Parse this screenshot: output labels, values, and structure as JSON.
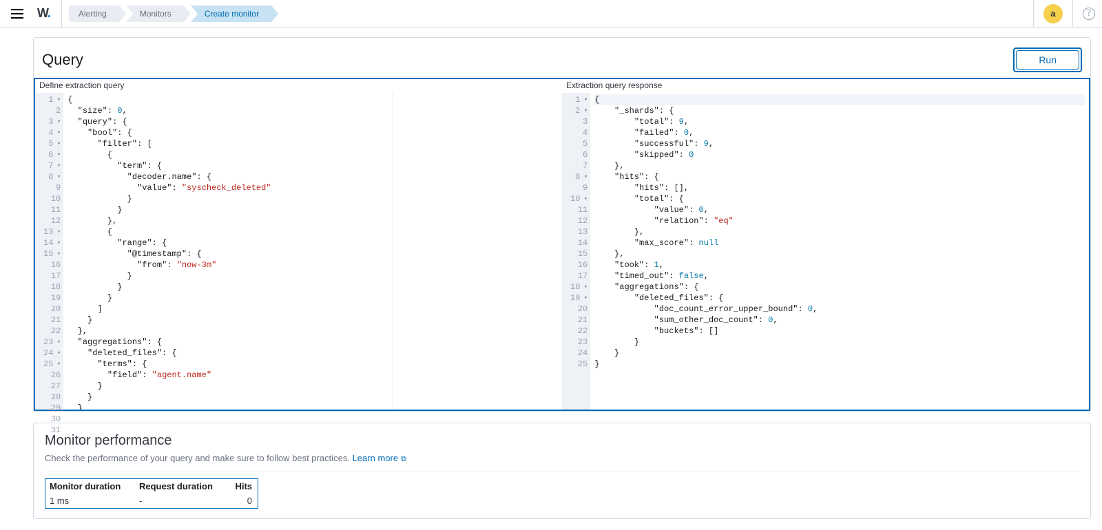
{
  "header": {
    "logo_text": "W",
    "avatar_letter": "a",
    "breadcrumbs": [
      "Alerting",
      "Monitors",
      "Create monitor"
    ]
  },
  "query_panel": {
    "title": "Query",
    "run_label": "Run",
    "left_label": "Define extraction query",
    "right_label": "Extraction query response"
  },
  "query_editor": {
    "lines": [
      {
        "n": 1,
        "fold": true,
        "tokens": [
          [
            "{",
            "punc"
          ]
        ]
      },
      {
        "n": 2,
        "tokens": [
          [
            "  ",
            ""
          ],
          [
            "\"size\"",
            "key"
          ],
          [
            ": ",
            "punc"
          ],
          [
            "0",
            "num"
          ],
          [
            ",",
            "punc"
          ]
        ]
      },
      {
        "n": 3,
        "fold": true,
        "tokens": [
          [
            "  ",
            ""
          ],
          [
            "\"query\"",
            "key"
          ],
          [
            ": {",
            "punc"
          ]
        ]
      },
      {
        "n": 4,
        "fold": true,
        "tokens": [
          [
            "    ",
            ""
          ],
          [
            "\"bool\"",
            "key"
          ],
          [
            ": {",
            "punc"
          ]
        ]
      },
      {
        "n": 5,
        "fold": true,
        "tokens": [
          [
            "      ",
            ""
          ],
          [
            "\"filter\"",
            "key"
          ],
          [
            ": [",
            "punc"
          ]
        ]
      },
      {
        "n": 6,
        "fold": true,
        "tokens": [
          [
            "        {",
            "punc"
          ]
        ]
      },
      {
        "n": 7,
        "fold": true,
        "tokens": [
          [
            "          ",
            ""
          ],
          [
            "\"term\"",
            "key"
          ],
          [
            ": {",
            "punc"
          ]
        ]
      },
      {
        "n": 8,
        "fold": true,
        "tokens": [
          [
            "            ",
            ""
          ],
          [
            "\"decoder.name\"",
            "key"
          ],
          [
            ": {",
            "punc"
          ]
        ]
      },
      {
        "n": 9,
        "tokens": [
          [
            "              ",
            ""
          ],
          [
            "\"value\"",
            "key"
          ],
          [
            ": ",
            "punc"
          ],
          [
            "\"syscheck_deleted\"",
            "str"
          ]
        ]
      },
      {
        "n": 10,
        "tokens": [
          [
            "            }",
            "punc"
          ]
        ]
      },
      {
        "n": 11,
        "tokens": [
          [
            "          }",
            "punc"
          ]
        ]
      },
      {
        "n": 12,
        "tokens": [
          [
            "        },",
            "punc"
          ]
        ]
      },
      {
        "n": 13,
        "fold": true,
        "tokens": [
          [
            "        {",
            "punc"
          ]
        ]
      },
      {
        "n": 14,
        "fold": true,
        "tokens": [
          [
            "          ",
            ""
          ],
          [
            "\"range\"",
            "key"
          ],
          [
            ": {",
            "punc"
          ]
        ]
      },
      {
        "n": 15,
        "fold": true,
        "tokens": [
          [
            "            ",
            ""
          ],
          [
            "\"@timestamp\"",
            "key"
          ],
          [
            ": {",
            "punc"
          ]
        ]
      },
      {
        "n": 16,
        "tokens": [
          [
            "              ",
            ""
          ],
          [
            "\"from\"",
            "key"
          ],
          [
            ": ",
            "punc"
          ],
          [
            "\"now-3m\"",
            "str"
          ]
        ]
      },
      {
        "n": 17,
        "tokens": [
          [
            "            }",
            "punc"
          ]
        ]
      },
      {
        "n": 18,
        "tokens": [
          [
            "          }",
            "punc"
          ]
        ]
      },
      {
        "n": 19,
        "tokens": [
          [
            "        }",
            "punc"
          ]
        ]
      },
      {
        "n": 20,
        "tokens": [
          [
            "      ]",
            "punc"
          ]
        ]
      },
      {
        "n": 21,
        "tokens": [
          [
            "    }",
            "punc"
          ]
        ]
      },
      {
        "n": 22,
        "tokens": [
          [
            "  },",
            "punc"
          ]
        ]
      },
      {
        "n": 23,
        "fold": true,
        "tokens": [
          [
            "  ",
            ""
          ],
          [
            "\"aggregations\"",
            "key"
          ],
          [
            ": {",
            "punc"
          ]
        ]
      },
      {
        "n": 24,
        "fold": true,
        "tokens": [
          [
            "    ",
            ""
          ],
          [
            "\"deleted_files\"",
            "key"
          ],
          [
            ": {",
            "punc"
          ]
        ]
      },
      {
        "n": 25,
        "fold": true,
        "tokens": [
          [
            "      ",
            ""
          ],
          [
            "\"terms\"",
            "key"
          ],
          [
            ": {",
            "punc"
          ]
        ]
      },
      {
        "n": 26,
        "tokens": [
          [
            "        ",
            ""
          ],
          [
            "\"field\"",
            "key"
          ],
          [
            ": ",
            "punc"
          ],
          [
            "\"agent.name\"",
            "str"
          ]
        ]
      },
      {
        "n": 27,
        "tokens": [
          [
            "      }",
            "punc"
          ]
        ]
      },
      {
        "n": 28,
        "tokens": [
          [
            "    }",
            "punc"
          ]
        ]
      },
      {
        "n": 29,
        "tokens": [
          [
            "  }",
            "punc"
          ]
        ]
      },
      {
        "n": 30,
        "tokens": [
          [
            "}",
            "punc"
          ]
        ]
      },
      {
        "n": 31,
        "hl": true,
        "tokens": [
          [
            "",
            ""
          ]
        ]
      }
    ]
  },
  "response_editor": {
    "lines": [
      {
        "n": 1,
        "fold": true,
        "hl": true,
        "tokens": [
          [
            "{",
            "punc"
          ]
        ]
      },
      {
        "n": 2,
        "fold": true,
        "tokens": [
          [
            "    ",
            ""
          ],
          [
            "\"_shards\"",
            "key"
          ],
          [
            ": {",
            "punc"
          ]
        ]
      },
      {
        "n": 3,
        "tokens": [
          [
            "        ",
            ""
          ],
          [
            "\"total\"",
            "key"
          ],
          [
            ": ",
            "punc"
          ],
          [
            "9",
            "num"
          ],
          [
            ",",
            "punc"
          ]
        ]
      },
      {
        "n": 4,
        "tokens": [
          [
            "        ",
            ""
          ],
          [
            "\"failed\"",
            "key"
          ],
          [
            ": ",
            "punc"
          ],
          [
            "0",
            "num"
          ],
          [
            ",",
            "punc"
          ]
        ]
      },
      {
        "n": 5,
        "tokens": [
          [
            "        ",
            ""
          ],
          [
            "\"successful\"",
            "key"
          ],
          [
            ": ",
            "punc"
          ],
          [
            "9",
            "num"
          ],
          [
            ",",
            "punc"
          ]
        ]
      },
      {
        "n": 6,
        "tokens": [
          [
            "        ",
            ""
          ],
          [
            "\"skipped\"",
            "key"
          ],
          [
            ": ",
            "punc"
          ],
          [
            "0",
            "num"
          ]
        ]
      },
      {
        "n": 7,
        "tokens": [
          [
            "    },",
            "punc"
          ]
        ]
      },
      {
        "n": 8,
        "fold": true,
        "tokens": [
          [
            "    ",
            ""
          ],
          [
            "\"hits\"",
            "key"
          ],
          [
            ": {",
            "punc"
          ]
        ]
      },
      {
        "n": 9,
        "tokens": [
          [
            "        ",
            ""
          ],
          [
            "\"hits\"",
            "key"
          ],
          [
            ": [],",
            "punc"
          ]
        ]
      },
      {
        "n": 10,
        "fold": true,
        "tokens": [
          [
            "        ",
            ""
          ],
          [
            "\"total\"",
            "key"
          ],
          [
            ": {",
            "punc"
          ]
        ]
      },
      {
        "n": 11,
        "tokens": [
          [
            "            ",
            ""
          ],
          [
            "\"value\"",
            "key"
          ],
          [
            ": ",
            "punc"
          ],
          [
            "0",
            "num"
          ],
          [
            ",",
            "punc"
          ]
        ]
      },
      {
        "n": 12,
        "tokens": [
          [
            "            ",
            ""
          ],
          [
            "\"relation\"",
            "key"
          ],
          [
            ": ",
            "punc"
          ],
          [
            "\"eq\"",
            "str"
          ]
        ]
      },
      {
        "n": 13,
        "tokens": [
          [
            "        },",
            "punc"
          ]
        ]
      },
      {
        "n": 14,
        "tokens": [
          [
            "        ",
            ""
          ],
          [
            "\"max_score\"",
            "key"
          ],
          [
            ": ",
            "punc"
          ],
          [
            "null",
            "null"
          ]
        ]
      },
      {
        "n": 15,
        "tokens": [
          [
            "    },",
            "punc"
          ]
        ]
      },
      {
        "n": 16,
        "tokens": [
          [
            "    ",
            ""
          ],
          [
            "\"took\"",
            "key"
          ],
          [
            ": ",
            "punc"
          ],
          [
            "1",
            "num"
          ],
          [
            ",",
            "punc"
          ]
        ]
      },
      {
        "n": 17,
        "tokens": [
          [
            "    ",
            ""
          ],
          [
            "\"timed_out\"",
            "key"
          ],
          [
            ": ",
            "punc"
          ],
          [
            "false",
            "bool"
          ],
          [
            ",",
            "punc"
          ]
        ]
      },
      {
        "n": 18,
        "fold": true,
        "tokens": [
          [
            "    ",
            ""
          ],
          [
            "\"aggregations\"",
            "key"
          ],
          [
            ": {",
            "punc"
          ]
        ]
      },
      {
        "n": 19,
        "fold": true,
        "tokens": [
          [
            "        ",
            ""
          ],
          [
            "\"deleted_files\"",
            "key"
          ],
          [
            ": {",
            "punc"
          ]
        ]
      },
      {
        "n": 20,
        "tokens": [
          [
            "            ",
            ""
          ],
          [
            "\"doc_count_error_upper_bound\"",
            "key"
          ],
          [
            ": ",
            "punc"
          ],
          [
            "0",
            "num"
          ],
          [
            ",",
            "punc"
          ]
        ]
      },
      {
        "n": 21,
        "tokens": [
          [
            "            ",
            ""
          ],
          [
            "\"sum_other_doc_count\"",
            "key"
          ],
          [
            ": ",
            "punc"
          ],
          [
            "0",
            "num"
          ],
          [
            ",",
            "punc"
          ]
        ]
      },
      {
        "n": 22,
        "tokens": [
          [
            "            ",
            ""
          ],
          [
            "\"buckets\"",
            "key"
          ],
          [
            ": []",
            "punc"
          ]
        ]
      },
      {
        "n": 23,
        "tokens": [
          [
            "        }",
            "punc"
          ]
        ]
      },
      {
        "n": 24,
        "tokens": [
          [
            "    }",
            "punc"
          ]
        ]
      },
      {
        "n": 25,
        "tokens": [
          [
            "}",
            "punc"
          ]
        ]
      }
    ]
  },
  "perf": {
    "title": "Monitor performance",
    "subtitle": "Check the performance of your query and make sure to follow best practices.",
    "learn_more": "Learn more",
    "headers": {
      "dur": "Monitor duration",
      "req": "Request duration",
      "hits": "Hits"
    },
    "values": {
      "dur": "1 ms",
      "req": "-",
      "hits": "0"
    }
  }
}
